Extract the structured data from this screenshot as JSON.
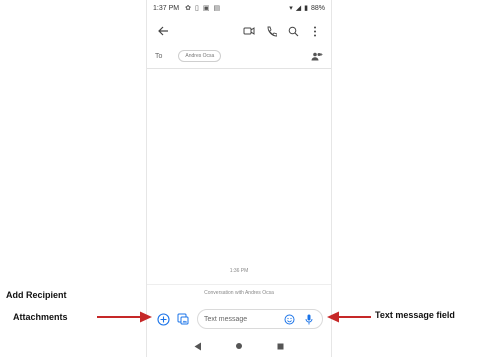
{
  "status_bar": {
    "time": "1:37 PM",
    "battery": "88%"
  },
  "header": {
    "icons": [
      "back-arrow-icon",
      "video-call-icon",
      "phone-icon",
      "search-icon",
      "more-vert-icon"
    ]
  },
  "recipient": {
    "to_label": "To",
    "chip_name": "Andres Ocsa"
  },
  "conversation": {
    "timestamp": "1:36 PM",
    "note": "Conversation with Andres Ocsa"
  },
  "compose": {
    "placeholder": "Text message"
  },
  "annotations": {
    "add_recipient": "Add Recipient",
    "attachments": "Attachments",
    "text_message_field": "Text message field"
  },
  "colors": {
    "accent": "#1a73e8",
    "arrow": "#c62828"
  }
}
